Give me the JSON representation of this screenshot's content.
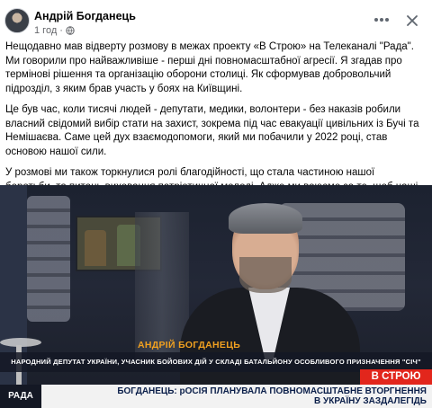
{
  "post": {
    "author": "Андрій Богданець",
    "time": "1 год",
    "paragraphs": [
      "Нещодавно мав відверту розмову в межах проекту «В Строю» на Телеканалі \"Рада\". Ми говорили про найважливіше - перші дні повномасштабної агресії. Я згадав про термінові рішення та організацію оборони столиці. Як сформував добровольчий підрозділ, з яким брав участь у боях на Київщині.",
      "Це був час, коли тисячі людей - депутати, медики, волонтери - без наказів робили власний свідомий вибір стати на захист, зокрема під час евакуації цивільних із Бучі та Немішаєва. Саме цей дух взаємодопомоги, який ми побачили у 2022 році, став основою нашої сили.",
      "У розмові ми також торкнулися ролі благодійності, що стала частиною нашої боротьби, та питань виховання патріотичної молоді. Адже ми воюємо за те, щоб наші діти виросли у сильній і вільній Україні, пам'ятаючи ціну, яку за це платимо."
    ]
  },
  "icons": {
    "more": "more-horizontal-icon",
    "close": "close-icon",
    "audience": "globe-icon"
  },
  "video": {
    "lower_third_name": "АНДРІЙ БОГДАНЕЦЬ",
    "lower_third_desc": "НАРОДНИЙ ДЕПУТАТ УКРАЇНИ, УЧАСНИК БОЙОВИХ ДІЙ У СКЛАДІ БАТАЛЬЙОНУ ОСОБЛИВОГО ПРИЗНАЧЕННЯ \"СІЧ\"",
    "show_name": "В СТРОЮ",
    "channel": "РАДА",
    "ticker_line1": "БОГДАНЕЦЬ: рОСІЯ ПЛАНУВАЛА ПОВНОМАСШТАБНЕ ВТОРГНЕННЯ",
    "ticker_line2": "В УКРАЇНУ ЗАЗДАЛЕГІДЬ"
  },
  "colors": {
    "name_accent": "#f0a020",
    "show_tag": "#e2261c",
    "ticker_text": "#0b1f4a"
  }
}
